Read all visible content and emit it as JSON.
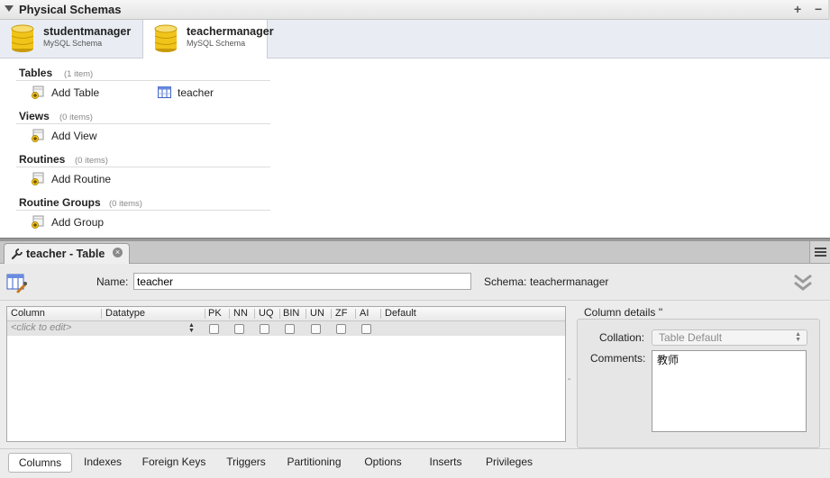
{
  "physical_schemas": {
    "title": "Physical Schemas",
    "add_symbol": "+",
    "remove_symbol": "−",
    "schemas": [
      {
        "name": "studentmanager",
        "type": "MySQL Schema"
      },
      {
        "name": "teachermanager",
        "type": "MySQL Schema",
        "selected": true
      }
    ],
    "sections": {
      "tables": {
        "title": "Tables",
        "count": "(1 item)",
        "add_label": "Add Table",
        "items": [
          "teacher"
        ]
      },
      "views": {
        "title": "Views",
        "count": "(0 items)",
        "add_label": "Add View"
      },
      "routines": {
        "title": "Routines",
        "count": "(0 items)",
        "add_label": "Add Routine"
      },
      "routine_groups": {
        "title": "Routine Groups",
        "count": "(0 items)",
        "add_label": "Add Group"
      }
    }
  },
  "editor": {
    "tab_label": "teacher - Table",
    "close_symbol": "×",
    "name_label": "Name:",
    "name_value": "teacher",
    "schema_label": "Schema:",
    "schema_value": "teachermanager",
    "grid": {
      "headers": [
        "Column",
        "Datatype",
        "PK",
        "NN",
        "UQ",
        "BIN",
        "UN",
        "ZF",
        "AI",
        "Default"
      ],
      "placeholder_row": "<click to edit>"
    },
    "column_details": {
      "title": "Column details ''",
      "collation_label": "Collation:",
      "collation_value": "Table Default",
      "comments_label": "Comments:",
      "comments_value": "教师"
    },
    "bottom_tabs": [
      "Columns",
      "Indexes",
      "Foreign Keys",
      "Triggers",
      "Partitioning",
      "Options",
      "Inserts",
      "Privileges"
    ],
    "selected_bottom_tab": "Columns"
  },
  "colors": {
    "db_icon": "#f0c419",
    "accent_blue": "#3b62c4"
  }
}
